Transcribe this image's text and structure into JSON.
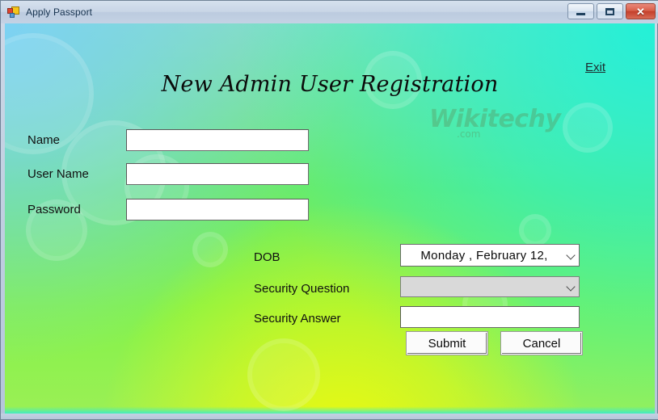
{
  "window": {
    "title": "Apply Passport",
    "icon": "vb-form-icon",
    "controls": {
      "minimize": "minimize-button",
      "maximize": "maximize-button",
      "close": "close-button",
      "close_glyph": "✕"
    }
  },
  "theme": {
    "bg_top_left": "#7DD2F3",
    "bg_top_right": "#23F0D7",
    "bg_bottom_left": "#9BF06B",
    "bg_bottom_center": "#E8F511",
    "bg_bottom_right": "#8CF04E",
    "titlebar": "#C8D5E6",
    "close_button": "#C4402C",
    "text": "#101010"
  },
  "form": {
    "heading": "New Admin User Registration",
    "exit_link": "Exit",
    "watermark": {
      "name": "Wikitechy",
      "suffix": ".com"
    },
    "fields": [
      {
        "label": "Name",
        "value": "",
        "placeholder": ""
      },
      {
        "label": "User Name",
        "value": "",
        "placeholder": ""
      },
      {
        "label": "Password",
        "value": "",
        "placeholder": ""
      }
    ],
    "dob": {
      "label": "DOB",
      "value": "Monday  ,  February  12,",
      "arrow_icon": "chevron-down-icon"
    },
    "security_question": {
      "label": "Security Question",
      "value": "",
      "arrow_icon": "chevron-down-icon"
    },
    "security_answer": {
      "label": "Security Answer",
      "value": "",
      "placeholder": ""
    },
    "buttons": {
      "submit": "Submit",
      "cancel": "Cancel"
    }
  }
}
